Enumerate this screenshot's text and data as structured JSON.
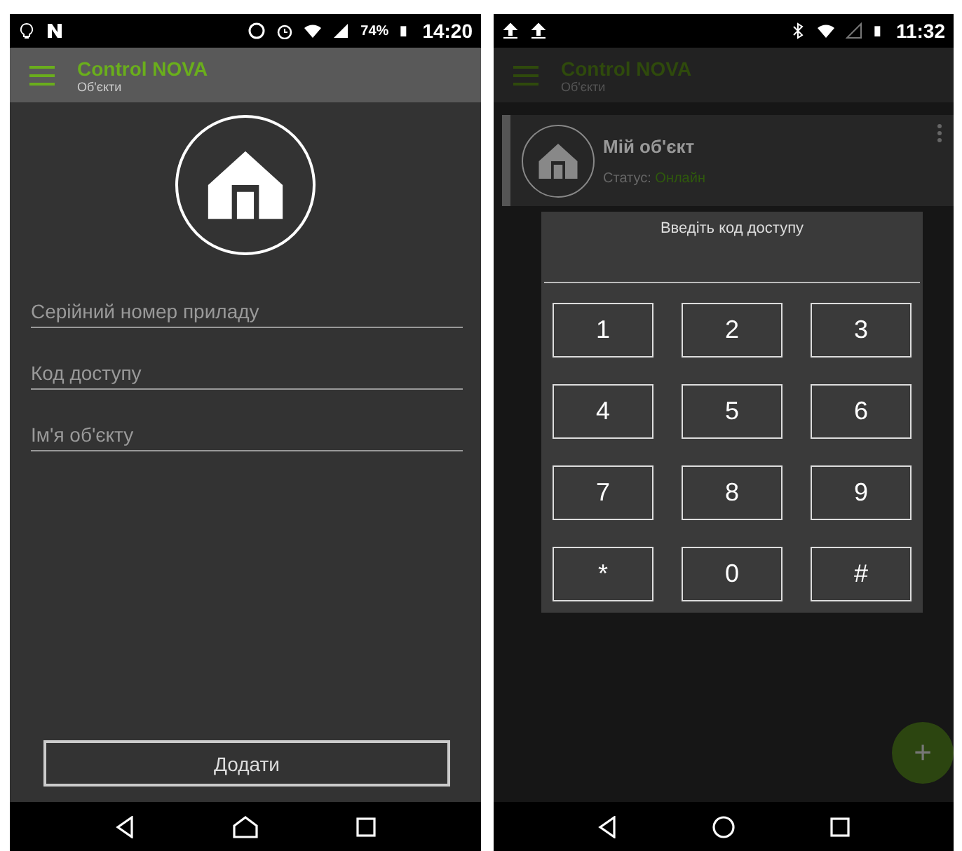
{
  "form_screen": {
    "status_bar": {
      "battery": "74%",
      "time": "14:20"
    },
    "app_bar": {
      "title": "Control NOVA",
      "subtitle": "Об'єкти"
    },
    "fields": [
      {
        "placeholder": "Серійний номер приладу"
      },
      {
        "placeholder": "Код доступу"
      },
      {
        "placeholder": "Ім'я об'єкту"
      }
    ],
    "button": "Додати"
  },
  "keypad_screen": {
    "status_bar": {
      "time": "11:32"
    },
    "app_bar": {
      "title": "Control NOVA",
      "subtitle": "Об'єкти"
    },
    "object_card": {
      "name": "Мій об'єкт",
      "status_label": "Статус:",
      "status_value": "Онлайн"
    },
    "dialog": {
      "title": "Введіть код доступу",
      "keys": [
        {
          "label": "1"
        },
        {
          "label": "2"
        },
        {
          "label": "3"
        },
        {
          "label": "4"
        },
        {
          "label": "5"
        },
        {
          "label": "6"
        },
        {
          "label": "7"
        },
        {
          "label": "8"
        },
        {
          "label": "9"
        },
        {
          "label": "*"
        },
        {
          "label": "0"
        },
        {
          "label": "#"
        }
      ]
    },
    "fab": "+"
  }
}
